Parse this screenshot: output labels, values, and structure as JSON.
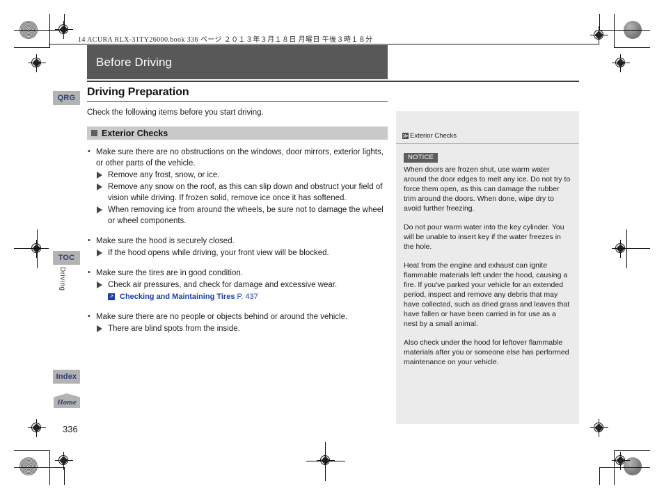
{
  "print": {
    "file_info": "14 ACURA RLX-31TY26000.book   336 ページ   ２０１３年３月１８日   月曜日   午後３時１８分"
  },
  "chapter": {
    "banner_title": "Before Driving"
  },
  "tabs": {
    "qrg": "QRG",
    "toc": "TOC",
    "index": "Index",
    "home": "Home",
    "vertical_label": "Driving"
  },
  "main": {
    "section_title": "Driving Preparation",
    "lead": "Check the following items before you start driving.",
    "subhead": "Exterior Checks",
    "items": [
      {
        "bullet": "Make sure there are no obstructions on the windows, door mirrors, exterior lights, or other parts of the vehicle.",
        "subitems": [
          "Remove any frost, snow, or ice.",
          "Remove any snow on the roof, as this can slip down and obstruct your field of vision while driving. If frozen solid, remove ice once it has softened.",
          "When removing ice from around the wheels, be sure not to damage the wheel or wheel components."
        ]
      },
      {
        "bullet": "Make sure the hood is securely closed.",
        "subitems": [
          "If the hood opens while driving, your front view will be blocked."
        ]
      },
      {
        "bullet": "Make sure the tires are in good condition.",
        "subitems": [
          "Check air pressures, and check for damage and excessive wear."
        ],
        "link": {
          "icon": "↗",
          "text": "Checking and Maintaining Tires",
          "page": "P. 437"
        }
      },
      {
        "bullet": "Make sure there are no people or objects behind or around the vehicle.",
        "subitems": [
          "There are blind spots from the inside."
        ]
      }
    ]
  },
  "side_panel": {
    "header": "Exterior Checks",
    "header_icon": "≫",
    "notice_label": "NOTICE",
    "paragraphs": [
      "When doors are frozen shut, use warm water around the door edges to melt any ice. Do not try to force them open, as this can damage the rubber trim around the doors. When done, wipe dry to avoid further freezing.",
      "Do not pour warm water into the key cylinder. You will be unable to insert key if the water freezes in the hole.",
      "Heat from the engine and exhaust can ignite flammable materials left under the hood, causing a fire. If you've parked your vehicle for an extended period, inspect and remove any debris that may have collected, such as dried grass and leaves that have fallen or have been carried in for use as a nest by a small animal.",
      "Also check under the hood for leftover flammable materials after you or someone else has performed maintenance on your vehicle."
    ]
  },
  "footer": {
    "page_number": "336"
  },
  "colors": {
    "banner": "#585858",
    "tab": "#b3b3b3",
    "tab_text": "#2d3c72",
    "subhead_bg": "#c9c9c9",
    "side_panel_bg": "#ebebeb",
    "link": "#1b3faa"
  }
}
